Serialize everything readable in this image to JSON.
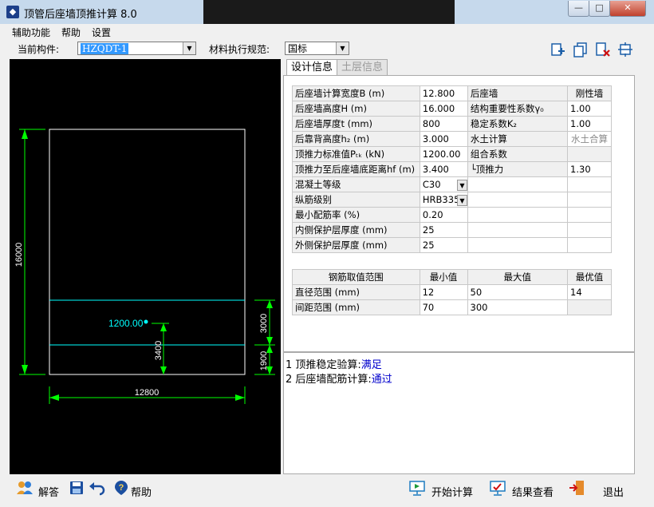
{
  "window": {
    "title": "顶管后座墙顶推计算 8.0",
    "min_label": "—",
    "max_label": "□",
    "close_label": "✕"
  },
  "menu": [
    "辅助功能",
    "帮助",
    "设置"
  ],
  "toolbar": {
    "component_label": "当前构件:",
    "component_value": "HZQDT-1",
    "spec_label": "材料执行规范:",
    "spec_value": "国标"
  },
  "tabs": [
    "设计信息",
    "土层信息"
  ],
  "design_rows": [
    {
      "label": "后座墙计算宽度B (m)",
      "value": "12.800",
      "label2": "后座墙",
      "value2": "刚性墙"
    },
    {
      "label": "后座墙高度H (m)",
      "value": "16.000",
      "label2": "结构重要性系数γ₀",
      "value2": "1.00"
    },
    {
      "label": "后座墙厚度t (mm)",
      "value": "800",
      "label2": "稳定系数K₂",
      "value2": "1.00"
    },
    {
      "label": "后靠背高度h₂ (m)",
      "value": "3.000",
      "label2": "水土计算",
      "value2": "水土合算"
    },
    {
      "label": "顶推力标准值Pₜₖ (kN)",
      "value": "1200.00",
      "label2": "组合系数",
      "value2": ""
    },
    {
      "label": "顶推力至后座墙底距离hf (m)",
      "value": "3.400",
      "label2": "└顶推力",
      "value2": "1.30"
    },
    {
      "label": "混凝土等级",
      "value": "C30",
      "label2": "",
      "value2": ""
    },
    {
      "label": "纵筋级别",
      "value": "HRB335",
      "label2": "",
      "value2": ""
    },
    {
      "label": "最小配筋率 (%)",
      "value": "0.20",
      "label2": "",
      "value2": ""
    },
    {
      "label": "内侧保护层厚度 (mm)",
      "value": "25",
      "label2": "",
      "value2": ""
    },
    {
      "label": "外侧保护层厚度 (mm)",
      "value": "25",
      "label2": "",
      "value2": ""
    }
  ],
  "rebar": {
    "headers": [
      "钢筋取值范围",
      "最小值",
      "最大值",
      "最优值"
    ],
    "rows": [
      {
        "label": "直径范围 (mm)",
        "min": "12",
        "max": "50",
        "best": "14"
      },
      {
        "label": "间距范围 (mm)",
        "min": "70",
        "max": "300",
        "best": ""
      }
    ]
  },
  "output": [
    {
      "prefix": "1 顶推稳定验算:",
      "result": "满足"
    },
    {
      "prefix": "2 后座墙配筋计算:",
      "result": "通过"
    }
  ],
  "drawing": {
    "dim_height": "16000",
    "dim_width": "12800",
    "dim_upper": "3000",
    "dim_lower": "1900",
    "dim_force_height": "3400",
    "force_label": "1200.00"
  },
  "bottom": {
    "answer": "解答",
    "help": "帮助",
    "start": "开始计算",
    "view": "结果查看",
    "exit": "退出"
  },
  "colors": {
    "cyan": "#00ffff",
    "green": "#00ff00",
    "link": "#0000cc"
  }
}
